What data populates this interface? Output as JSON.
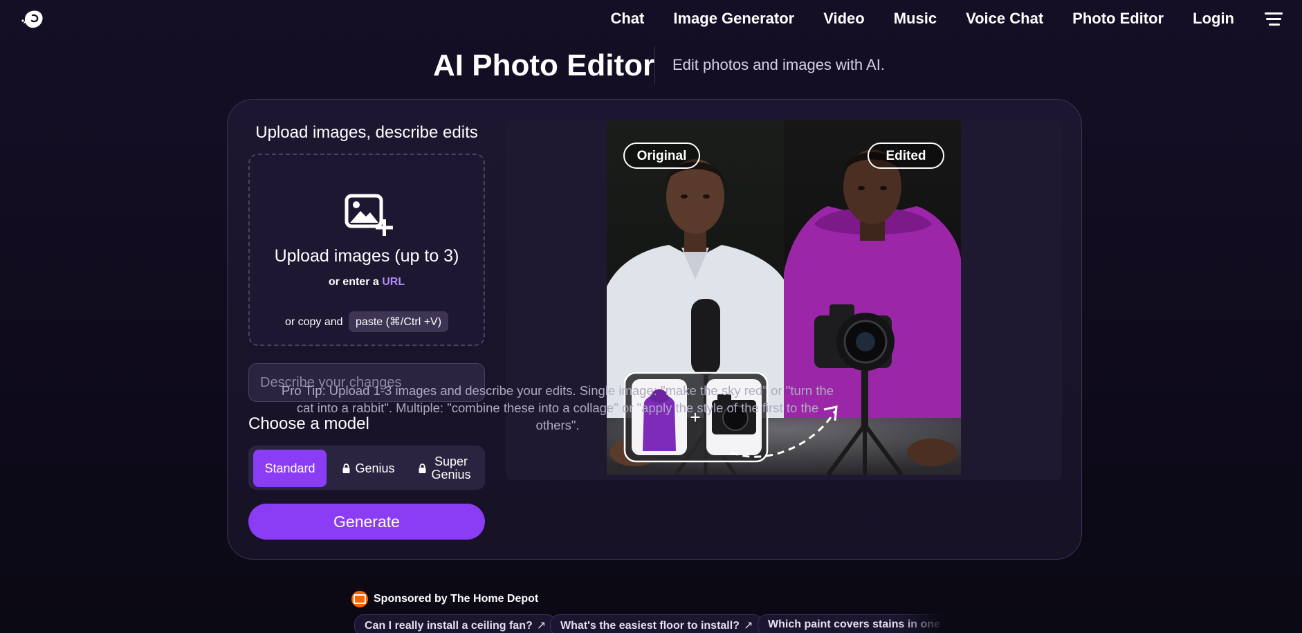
{
  "nav": {
    "logo_icon": "dolphin-logo-icon",
    "links": [
      "Chat",
      "Image Generator",
      "Video",
      "Music",
      "Voice Chat",
      "Photo Editor",
      "Login"
    ],
    "menu_icon": "hamburger-menu-icon"
  },
  "header": {
    "title": "AI Photo Editor",
    "subtitle": "Edit photos and images with AI."
  },
  "upload": {
    "heading": "Upload images, describe edits",
    "main_label": "Upload images (up to 3)",
    "or_enter": "or enter a",
    "url_label": "URL",
    "or_copy": "or copy and",
    "paste_label": "paste (⌘/Ctrl +V)"
  },
  "describe": {
    "placeholder": "Describe your changes"
  },
  "model": {
    "heading": "Choose a model",
    "options": [
      "Standard",
      "Genius",
      "Super Genius"
    ],
    "super_line1": "Super",
    "super_line2": "Genius",
    "selected": "Standard"
  },
  "generate_label": "Generate",
  "preview": {
    "badge_original": "Original",
    "badge_edited": "Edited",
    "plus": "+"
  },
  "pro_tip": "Pro Tip: Upload 1-3 images and describe your edits. Single image: \"make the sky red\" or \"turn the cat into a rabbit\". Multiple: \"combine these into a collage\" or \"apply the style of the first to the others\".",
  "sponsor": {
    "text": "Sponsored by The Home Depot",
    "chips": [
      "Can I really install a ceiling fan?",
      "What's the easiest floor to install?",
      "Which paint covers stains in one coat?"
    ]
  },
  "colors": {
    "accent": "#8b3df5",
    "background": "#120d22",
    "link": "#b18cf5",
    "sponsor_brand": "#f96302"
  }
}
